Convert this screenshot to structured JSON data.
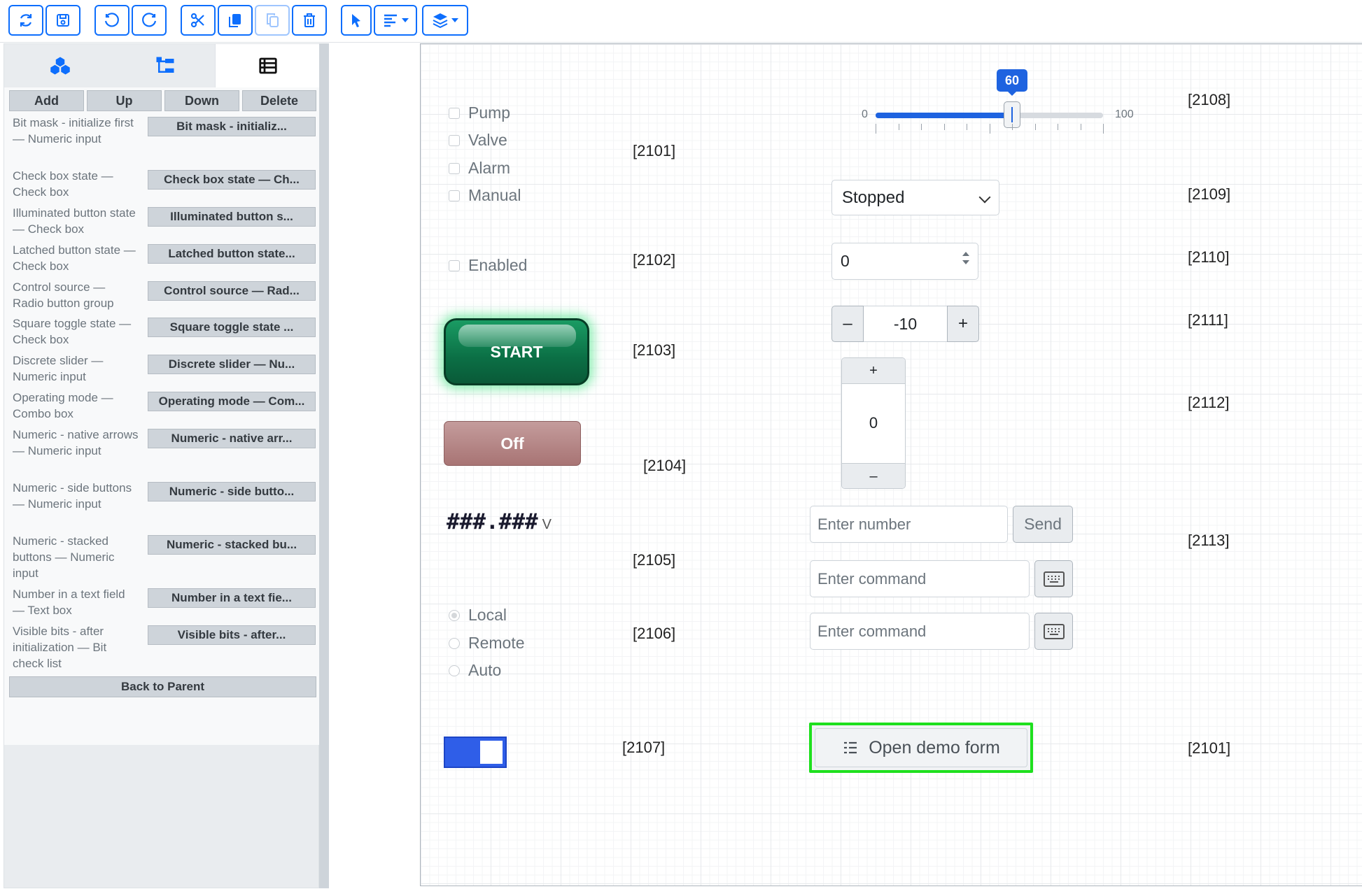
{
  "toolbar": {
    "icons": [
      "refresh-icon",
      "save-icon",
      "undo-icon",
      "redo-icon",
      "cut-icon",
      "copy-icon",
      "paste-icon",
      "trash-icon",
      "pointer-icon",
      "align-icon",
      "layers-icon"
    ]
  },
  "left_panel": {
    "tabs": [
      "components-icon",
      "tree-icon",
      "list-icon"
    ],
    "actions": {
      "add": "Add",
      "up": "Up",
      "down": "Down",
      "delete": "Delete"
    },
    "items": [
      {
        "label": "Bit mask - initialize first — Numeric input",
        "button": "Bit mask - initializ..."
      },
      {
        "label": "Check box state — Check box",
        "button": "Check box state — Ch..."
      },
      {
        "label": "Illuminated button state — Check box",
        "button": "Illuminated button s..."
      },
      {
        "label": "Latched button state — Check box",
        "button": "Latched button state..."
      },
      {
        "label": "Control source — Radio button group",
        "button": "Control source — Rad..."
      },
      {
        "label": "Square toggle state — Check box",
        "button": "Square toggle state ..."
      },
      {
        "label": "Discrete slider — Numeric input",
        "button": "Discrete slider — Nu..."
      },
      {
        "label": "Operating mode — Combo box",
        "button": "Operating mode — Com..."
      },
      {
        "label": "Numeric - native arrows — Numeric input",
        "button": "Numeric - native arr..."
      },
      {
        "label": "Numeric - side buttons — Numeric input",
        "button": "Numeric - side butto..."
      },
      {
        "label": "Numeric - stacked buttons — Numeric input",
        "button": "Numeric - stacked bu..."
      },
      {
        "label": "Number in a text field — Text box",
        "button": "Number in a text fie..."
      },
      {
        "label": "Visible bits - after initialization — Bit check list",
        "button": "Visible bits - after..."
      }
    ],
    "back": "Back to Parent"
  },
  "canvas": {
    "checklist": [
      "Pump",
      "Valve",
      "Alarm",
      "Manual"
    ],
    "enabled_label": "Enabled",
    "start_label": "START",
    "off_label": "Off",
    "mask_text": "###.###",
    "mask_unit": "V",
    "radios": [
      {
        "label": "Local",
        "checked": true
      },
      {
        "label": "Remote",
        "checked": false
      },
      {
        "label": "Auto",
        "checked": false
      }
    ],
    "toggle_on": true,
    "slider": {
      "min": "0",
      "max": "100",
      "value": 60
    },
    "mode_select": "Stopped",
    "native_value": "0",
    "side_value": "-10",
    "side_minus": "–",
    "side_plus": "+",
    "stack_value": "0",
    "stack_plus": "+",
    "stack_minus": "–",
    "number_placeholder": "Enter number",
    "send_label": "Send",
    "command_placeholder_1": "Enter command",
    "command_placeholder_2": "Enter command",
    "demo_button": "Open demo form",
    "tags": {
      "t2101a": "[2101]",
      "t2102": "[2102]",
      "t2103": "[2103]",
      "t2104": "[2104]",
      "t2105": "[2105]",
      "t2106": "[2106]",
      "t2107": "[2107]",
      "t2108": "[2108]",
      "t2109": "[2109]",
      "t2110": "[2110]",
      "t2111": "[2111]",
      "t2112": "[2112]",
      "t2113": "[2113]",
      "t2101b": "[2101]"
    }
  },
  "colors": {
    "accent": "#0d6efd",
    "start_green": "#0b6f45",
    "off_rose": "#a87474",
    "highlight_green": "#1ee01e",
    "slider_blue": "#1e63e0"
  }
}
